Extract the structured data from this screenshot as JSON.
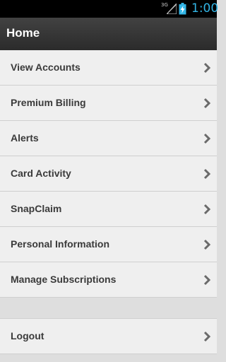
{
  "status_bar": {
    "network": "3G",
    "time": "1:00",
    "icons": [
      "signal-icon",
      "battery-charging-icon"
    ]
  },
  "action_bar": {
    "title": "Home"
  },
  "menu": {
    "items": [
      {
        "label": "View Accounts",
        "icon": "chevron-right-icon"
      },
      {
        "label": "Premium Billing",
        "icon": "chevron-right-icon"
      },
      {
        "label": "Alerts",
        "icon": "chevron-right-icon"
      },
      {
        "label": "Card Activity",
        "icon": "chevron-right-icon"
      },
      {
        "label": "SnapClaim",
        "icon": "chevron-right-icon"
      },
      {
        "label": "Personal Information",
        "icon": "chevron-right-icon"
      },
      {
        "label": "Manage Subscriptions",
        "icon": "chevron-right-icon"
      }
    ],
    "logout": {
      "label": "Logout",
      "icon": "chevron-right-icon"
    }
  },
  "colors": {
    "status_bar_bg": "#000000",
    "clock": "#33b5e5",
    "action_bar_bg": "#333333",
    "menu_item_bg": "#efefef",
    "menu_text": "#3a3a3a",
    "background": "#dedede"
  }
}
